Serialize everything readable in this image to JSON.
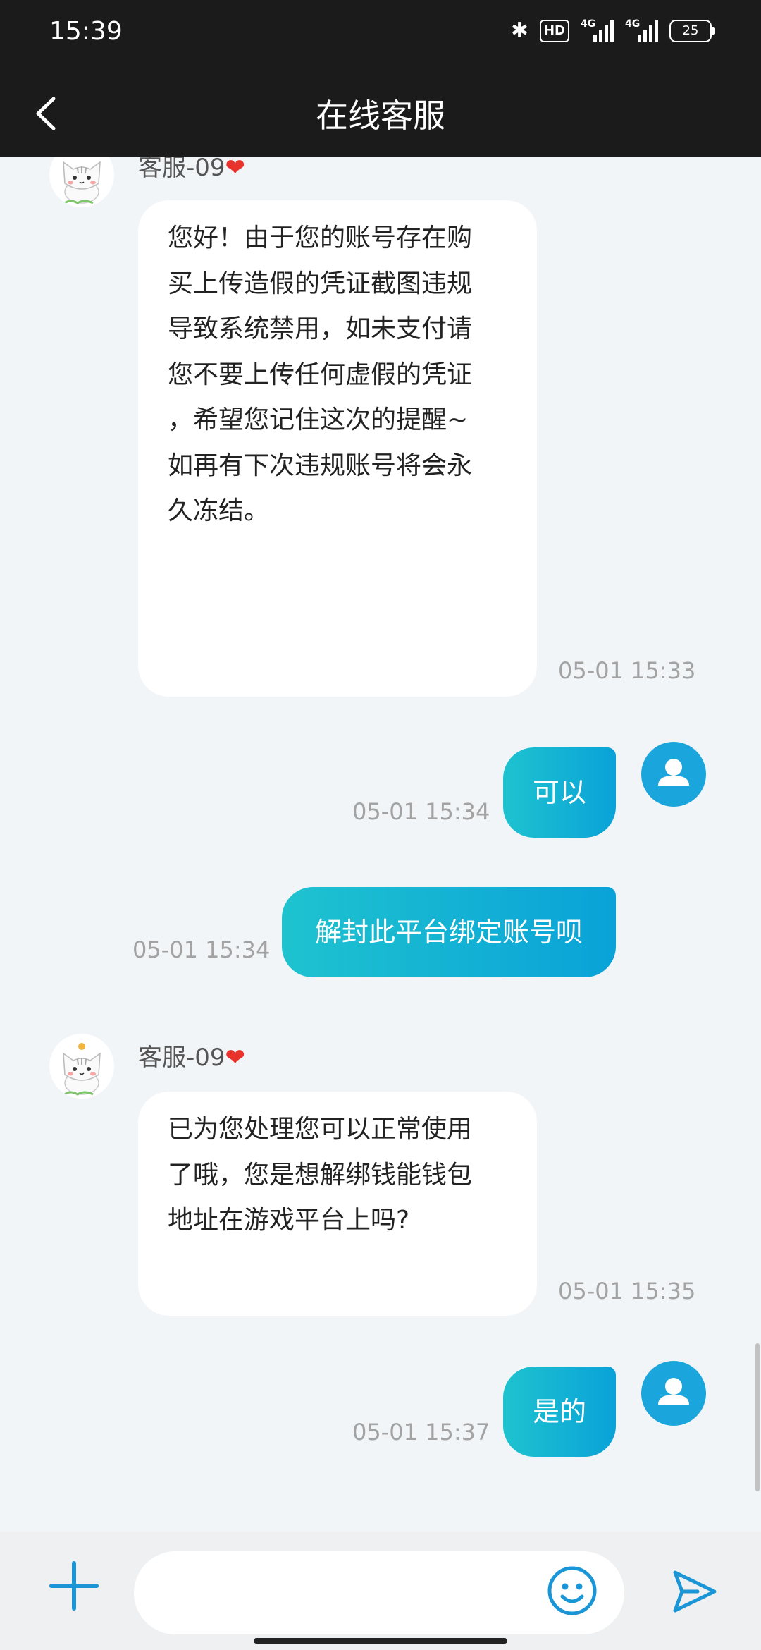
{
  "status_bar": {
    "time": "15:39",
    "icons": [
      "bluetooth-icon",
      "hd-icon",
      "signal-4g-icon",
      "signal-4g-icon",
      "battery-icon"
    ],
    "hd_label": "HD",
    "network_1": "4G",
    "network_2": "4G",
    "battery": "25"
  },
  "header": {
    "title": "在线客服",
    "back_icon": "chevron-left-icon"
  },
  "messages": [
    {
      "from": "agent",
      "sender": "客服-09",
      "sender_badge": "❤",
      "lines": [
        "您好！由于您的账号存在购",
        "买上传造假的凭证截图违规",
        "导致系统禁用，如未支付请",
        "您不要上传任何虚假的凭证",
        "，希望您记住这次的提醒~",
        "如再有下次违规账号将会永",
        "久冻结。"
      ],
      "time": "05-01 15:33"
    },
    {
      "from": "user",
      "text": "可以",
      "time": "05-01 15:34"
    },
    {
      "from": "user",
      "text": "解封此平台绑定账号呗",
      "time": "05-01 15:34"
    },
    {
      "from": "agent",
      "sender": "客服-09",
      "sender_badge": "❤",
      "lines": [
        "已为您处理您可以正常使用",
        "了哦，您是想解绑钱能钱包",
        "地址在游戏平台上吗?"
      ],
      "time": "05-01 15:35"
    },
    {
      "from": "user",
      "text": "是的",
      "time": "05-01 15:37"
    }
  ],
  "input_bar": {
    "placeholder": "",
    "icons": [
      "plus-icon",
      "emoji-icon",
      "send-icon"
    ]
  },
  "colors": {
    "header_bg": "#1b1b1b",
    "chat_bg": "#f2f5f8",
    "bubble_gradient_start": "#1ec3cf",
    "bubble_gradient_end": "#0aa2d8",
    "accent": "#1a96d6"
  }
}
